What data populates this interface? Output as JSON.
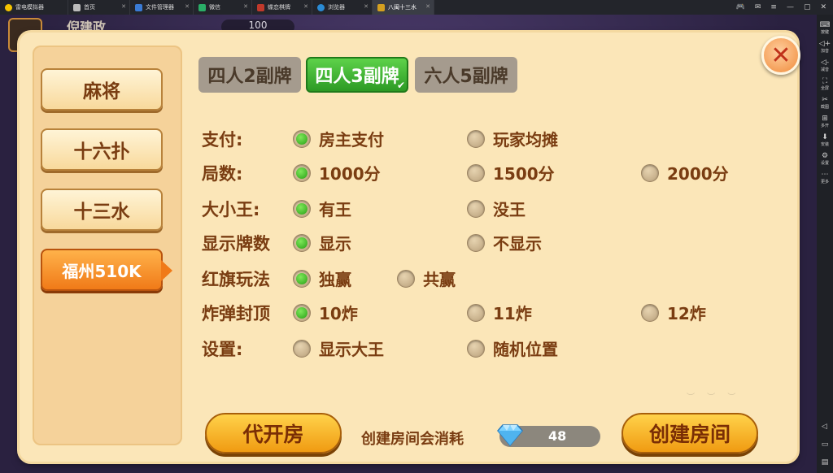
{
  "tabs": [
    {
      "label": "雷电模拟器",
      "color": "#f5c400",
      "active": false
    },
    {
      "label": "首页",
      "color": "#bbbbbb",
      "active": false
    },
    {
      "label": "文件管理器",
      "color": "#3a7bd5",
      "active": false
    },
    {
      "label": "微信",
      "color": "#2aae67",
      "active": false
    },
    {
      "label": "蝶恋棋牌",
      "color": "#c0392b",
      "active": false
    },
    {
      "label": "浏览器",
      "color": "#2a8bd5",
      "active": false
    },
    {
      "label": "八闽十三水",
      "color": "#d4a020",
      "active": true
    }
  ],
  "sidebar": {
    "items": [
      {
        "icon": "keyboard-icon",
        "glyph": "⌨",
        "label": "按键"
      },
      {
        "icon": "volume-up-icon",
        "glyph": "🔊",
        "label": "加音"
      },
      {
        "icon": "volume-down-icon",
        "glyph": "🔉",
        "label": "减音"
      },
      {
        "icon": "fullscreen-icon",
        "glyph": "⛶",
        "label": "全屏"
      },
      {
        "icon": "screenshot-icon",
        "glyph": "✂",
        "label": "截图"
      },
      {
        "icon": "multi-open-icon",
        "glyph": "⊞",
        "label": "多开"
      },
      {
        "icon": "install-icon",
        "glyph": "⬇",
        "label": "安装"
      },
      {
        "icon": "settings-icon",
        "glyph": "⚙",
        "label": "设置"
      },
      {
        "icon": "more-icon",
        "glyph": "⋯",
        "label": "更多"
      }
    ]
  },
  "background": {
    "name": "倪建政",
    "coins": "100"
  },
  "left_menu": [
    {
      "label": "麻将",
      "active": false
    },
    {
      "label": "十六扑",
      "active": false
    },
    {
      "label": "十三水",
      "active": false
    },
    {
      "label": "福州510K",
      "active": true
    }
  ],
  "mode_tabs": [
    {
      "label": "四人2副牌",
      "active": false
    },
    {
      "label": "四人3副牌",
      "active": true
    },
    {
      "label": "六人5副牌",
      "active": false
    }
  ],
  "rows": [
    {
      "label": "支付:",
      "options": [
        {
          "label": "房主支付",
          "selected": true
        },
        {
          "label": "玩家均摊",
          "selected": false
        }
      ]
    },
    {
      "label": "局数:",
      "options": [
        {
          "label": "1000分",
          "selected": true
        },
        {
          "label": "1500分",
          "selected": false
        },
        {
          "label": "2000分",
          "selected": false
        }
      ]
    },
    {
      "label": "大小王:",
      "options": [
        {
          "label": "有王",
          "selected": true
        },
        {
          "label": "没王",
          "selected": false
        }
      ]
    },
    {
      "label": "显示牌数",
      "options": [
        {
          "label": "显示",
          "selected": true
        },
        {
          "label": "不显示",
          "selected": false
        }
      ]
    },
    {
      "label": "红旗玩法",
      "options": [
        {
          "label": "独赢",
          "selected": true
        },
        {
          "label": "共赢",
          "selected": false
        }
      ]
    },
    {
      "label": "炸弹封顶",
      "options": [
        {
          "label": "10炸",
          "selected": true
        },
        {
          "label": "11炸",
          "selected": false
        },
        {
          "label": "12炸",
          "selected": false
        }
      ]
    },
    {
      "label": "设置:",
      "options": [
        {
          "label": "显示大王",
          "selected": false
        },
        {
          "label": "随机位置",
          "selected": false
        }
      ]
    }
  ],
  "footer": {
    "proxy_button": "代开房",
    "cost_text": "创建房间会消耗",
    "cost_value": "48",
    "create_button": "创建房间"
  },
  "colors": {
    "accent_green": "#2c9a24",
    "accent_orange": "#f07a18",
    "text_brown": "#7a3d12"
  }
}
